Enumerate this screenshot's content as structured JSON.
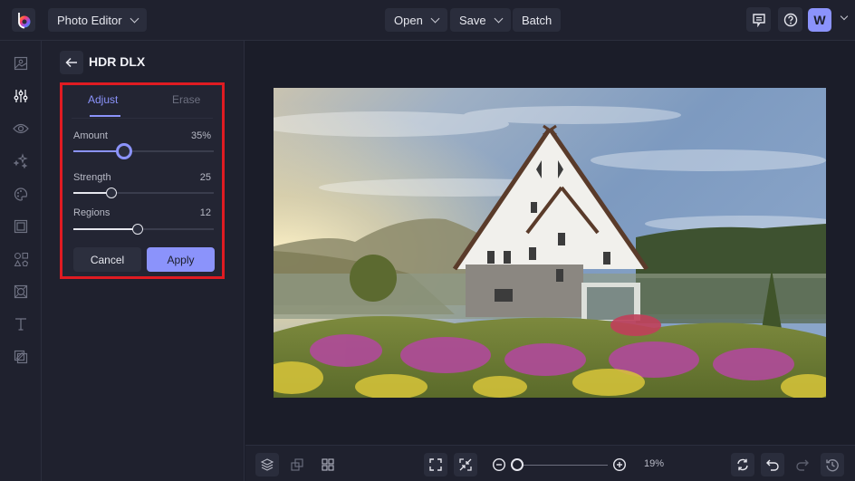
{
  "app": {
    "name": "Photo Editor",
    "logo_icon": "befunky-logo-icon"
  },
  "topbar": {
    "app_switcher_label": "Photo Editor",
    "open_label": "Open",
    "save_label": "Save",
    "batch_label": "Batch",
    "comments_icon": "comment-icon",
    "help_icon": "help-icon",
    "avatar_initial": "W"
  },
  "leftbar": {
    "items": [
      {
        "name": "image-manager",
        "icon": "image-icon"
      },
      {
        "name": "edit",
        "icon": "sliders-icon",
        "active": true
      },
      {
        "name": "touch-up",
        "icon": "eye-icon"
      },
      {
        "name": "effects",
        "icon": "sparkles-icon"
      },
      {
        "name": "artsy",
        "icon": "palette-icon"
      },
      {
        "name": "frames",
        "icon": "frame-icon"
      },
      {
        "name": "graphics",
        "icon": "shapes-icon"
      },
      {
        "name": "overlays",
        "icon": "overlay-icon"
      },
      {
        "name": "text",
        "icon": "text-icon"
      },
      {
        "name": "textures",
        "icon": "textures-icon"
      }
    ]
  },
  "panel": {
    "title": "HDR DLX",
    "tabs": [
      {
        "label": "Adjust",
        "active": true
      },
      {
        "label": "Erase",
        "active": false
      }
    ],
    "sliders": [
      {
        "label": "Amount",
        "value_text": "35%",
        "fraction": 0.36
      },
      {
        "label": "Strength",
        "value_text": "25",
        "fraction": 0.27
      },
      {
        "label": "Regions",
        "value_text": "12",
        "fraction": 0.46
      }
    ],
    "cancel_label": "Cancel",
    "apply_label": "Apply"
  },
  "canvas": {
    "photo_description": "White A-frame house with flower garden, lake and misty hills at sunrise"
  },
  "bottombar": {
    "zoom_percent": "19%",
    "zoom_fraction": 0.0,
    "left_tools": [
      "layers-icon",
      "resize-icon",
      "grid-icon"
    ],
    "center_tools": [
      "fit-screen-icon",
      "actual-size-icon",
      "zoom-out-icon",
      "zoom-in-icon"
    ],
    "right_tools": [
      "reset-icon",
      "undo-icon",
      "redo-icon",
      "history-icon"
    ]
  },
  "colors": {
    "accent": "#8b93fb",
    "highlight_border": "#e01b22",
    "background": "#1b1d29",
    "panel": "#1f212e"
  }
}
